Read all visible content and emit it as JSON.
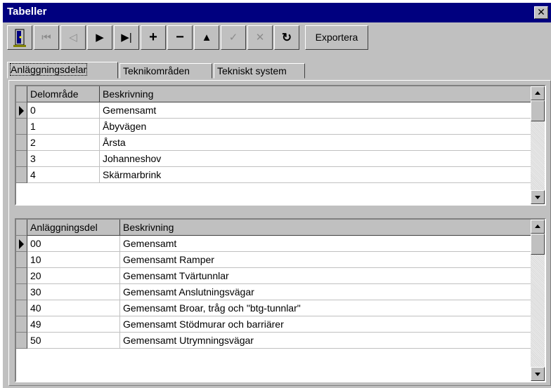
{
  "window": {
    "title": "Tabeller",
    "close_symbol": "✕"
  },
  "toolbar": {
    "buttons": [
      {
        "icon": "exit-door-icon",
        "enabled": true
      },
      {
        "icon": "first-record-icon",
        "glyph": "⏮",
        "enabled": false
      },
      {
        "icon": "prior-record-icon",
        "glyph": "◁",
        "enabled": false
      },
      {
        "icon": "next-record-icon",
        "glyph": "▶",
        "enabled": true
      },
      {
        "icon": "last-record-icon",
        "glyph": "▶|",
        "enabled": true
      },
      {
        "icon": "insert-record-icon",
        "glyph": "+",
        "enabled": true
      },
      {
        "icon": "delete-record-icon",
        "glyph": "−",
        "enabled": true
      },
      {
        "icon": "edit-record-icon",
        "glyph": "▲",
        "enabled": true
      },
      {
        "icon": "post-checkmark-icon",
        "glyph": "✓",
        "enabled": false
      },
      {
        "icon": "cancel-x-icon",
        "glyph": "✕",
        "enabled": false
      },
      {
        "icon": "refresh-icon",
        "glyph": "↻",
        "enabled": true
      }
    ],
    "export_label": "Exportera"
  },
  "tabs": [
    {
      "label": "Anläggningsdelar",
      "active": true
    },
    {
      "label": "Teknikområden",
      "active": false
    },
    {
      "label": "Tekniskt system",
      "active": false
    }
  ],
  "grid_top": {
    "columns": [
      "Delområde",
      "Beskrivning"
    ],
    "rows": [
      [
        "0",
        "Gemensamt"
      ],
      [
        "1",
        "Åbyvägen"
      ],
      [
        "2",
        "Årsta"
      ],
      [
        "3",
        "Johanneshov"
      ],
      [
        "4",
        "Skärmarbrink"
      ]
    ],
    "current_row": 0
  },
  "grid_bottom": {
    "columns": [
      "Anläggningsdel",
      "Beskrivning"
    ],
    "rows": [
      [
        "00",
        "Gemensamt"
      ],
      [
        "10",
        "Gemensamt Ramper"
      ],
      [
        "20",
        "Gemensamt Tvärtunnlar"
      ],
      [
        "30",
        "Gemensamt Anslutningsvägar"
      ],
      [
        "40",
        "Gemensamt Broar, tråg och \"btg-tunnlar\""
      ],
      [
        "49",
        "Gemensamt Stödmurar och barriärer"
      ],
      [
        "50",
        "Gemensamt Utrymningsvägar"
      ]
    ],
    "current_row": 0
  },
  "colors": {
    "titlebar": "#00007f",
    "face": "#c0c0c0",
    "disabled": "#8c8c8c"
  }
}
